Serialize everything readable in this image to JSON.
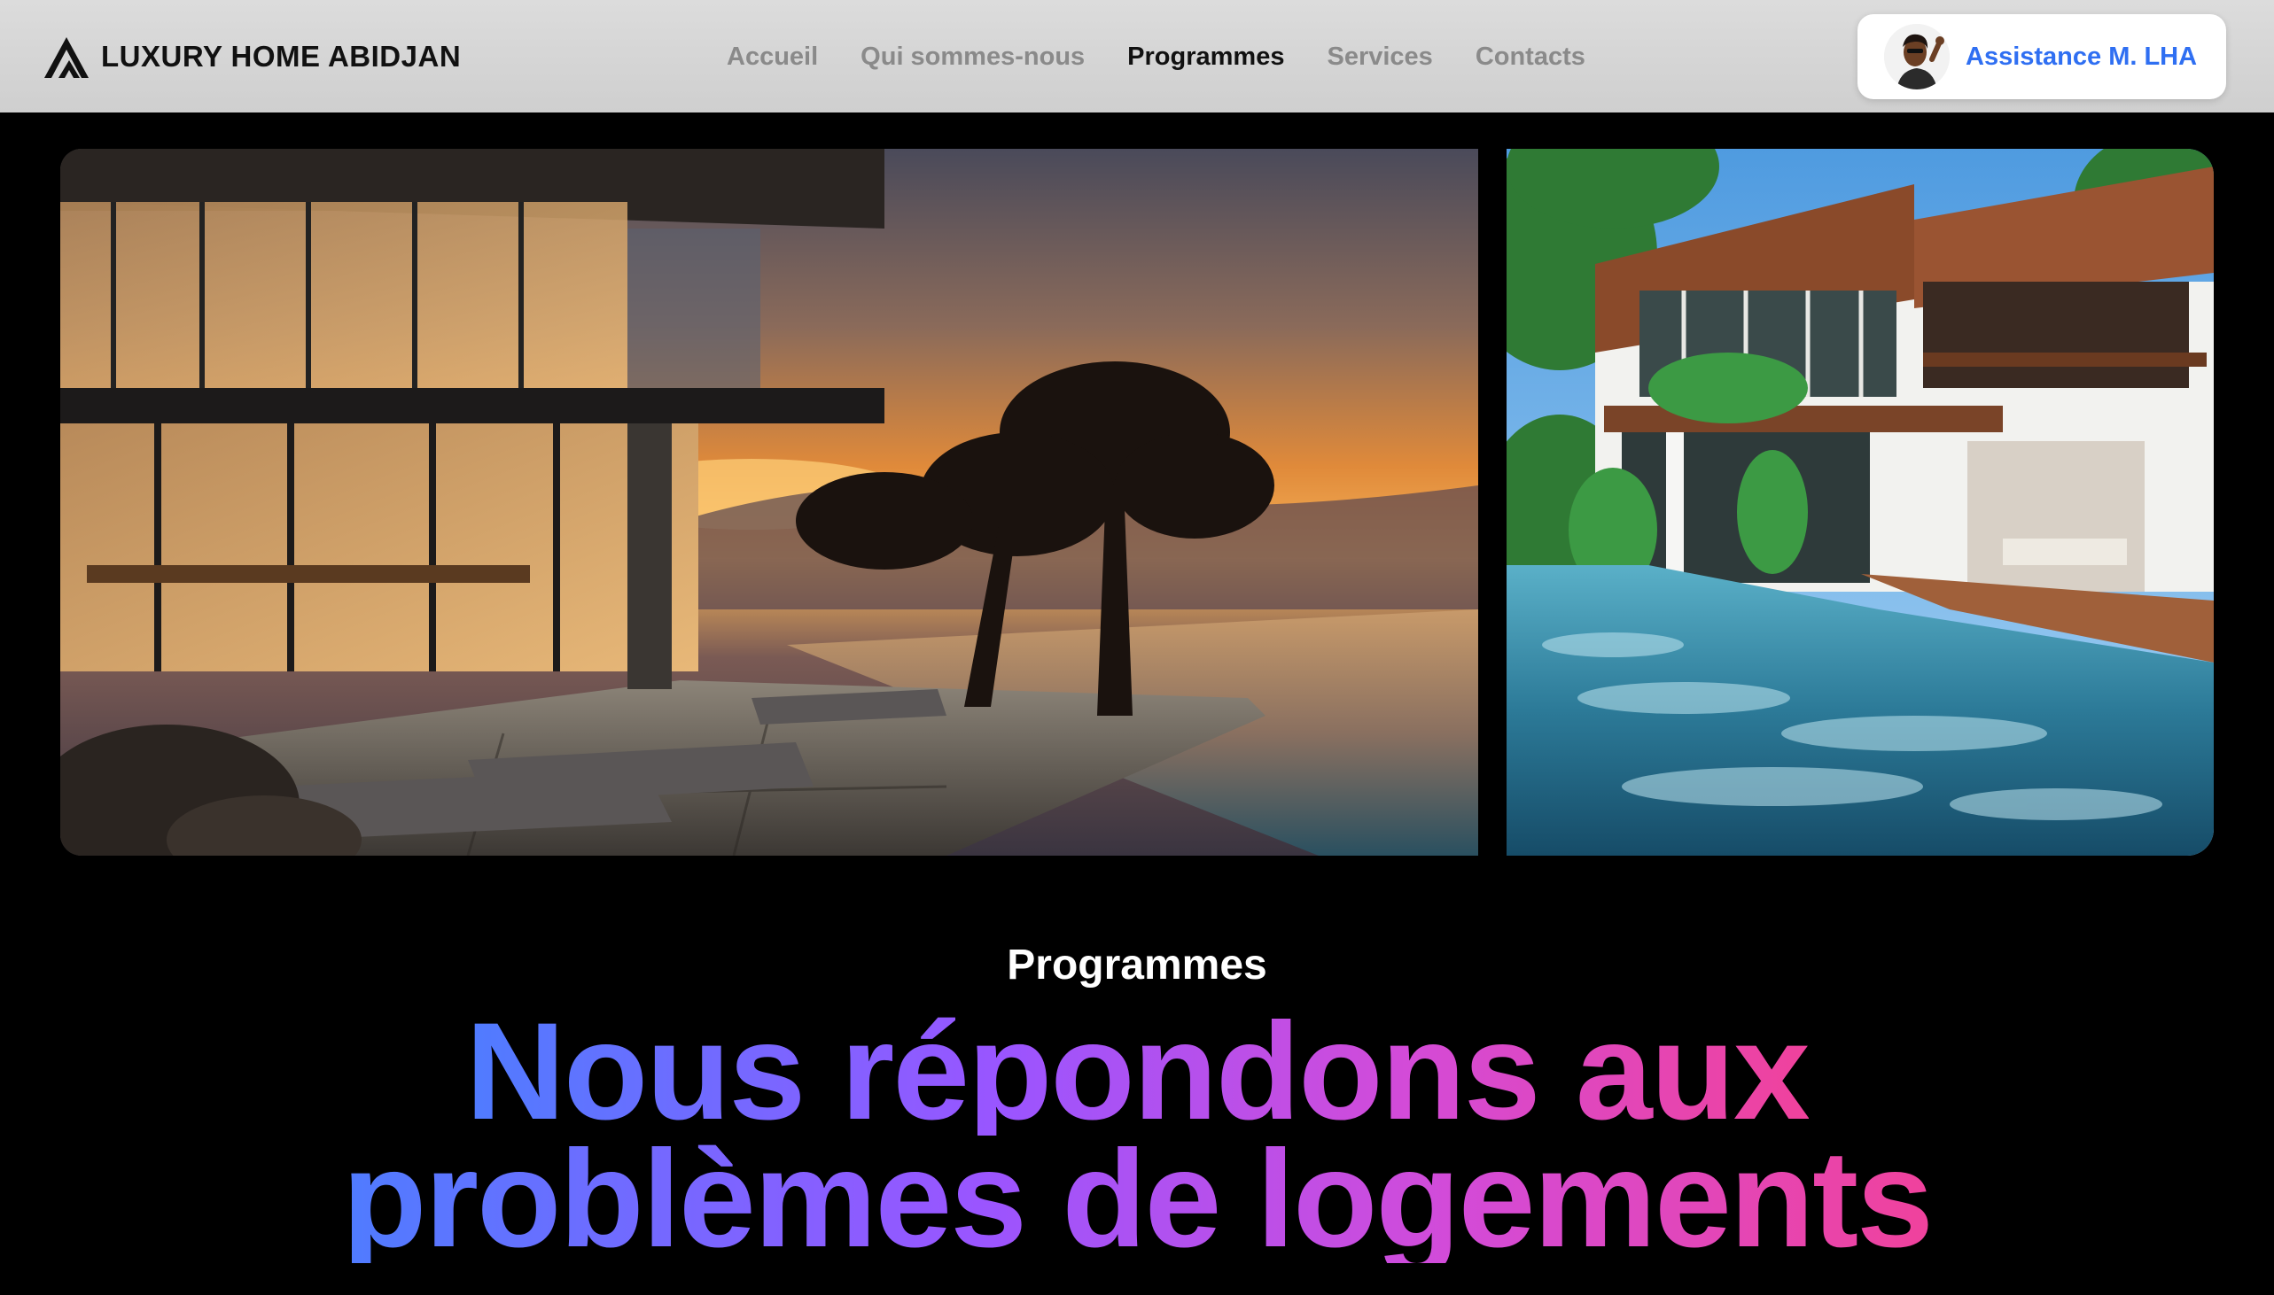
{
  "brand": {
    "name": "LUXURY HOME ABIDJAN",
    "icon": "mountain-logo-icon"
  },
  "nav": {
    "items": [
      {
        "label": "Accueil",
        "active": false
      },
      {
        "label": "Qui sommes-nous",
        "active": false
      },
      {
        "label": "Programmes",
        "active": true
      },
      {
        "label": "Services",
        "active": false
      },
      {
        "label": "Contacts",
        "active": false
      }
    ]
  },
  "assistance": {
    "label": "Assistance M. LHA",
    "avatar": "memoji-avatar-icon"
  },
  "hero": {
    "images": [
      {
        "name": "villa-sunset-pool-image"
      },
      {
        "name": "tropical-villa-pool-image"
      }
    ]
  },
  "section": {
    "eyebrow": "Programmes",
    "headline_line1": "Nous répondons aux",
    "headline_line2": "problèmes de logements"
  },
  "colors": {
    "accent_blue": "#2f6ff2",
    "gradient_start": "#4f7cff",
    "gradient_mid": "#9a55ff",
    "gradient_end": "#f0429c"
  }
}
